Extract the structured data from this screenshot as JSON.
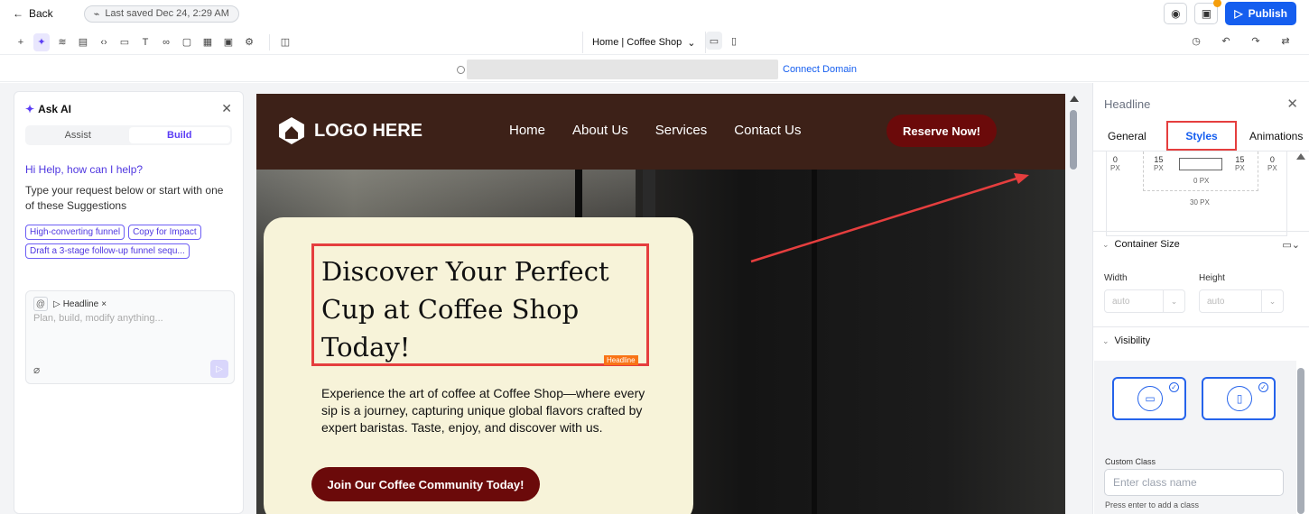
{
  "topbar": {
    "back_label": "Back",
    "saved_label": "Last saved Dec 24, 2:29 AM",
    "publish_label": "Publish",
    "icons": [
      "eye-icon",
      "save-icon",
      "publish-icon"
    ]
  },
  "toolbar": {
    "tools": [
      "add-icon",
      "ai-sparkle-icon",
      "layers-icon",
      "pages-icon",
      "code-icon",
      "forms-icon",
      "text-icon",
      "integrations-icon",
      "sections-icon",
      "templates-icon",
      "media-icon",
      "settings-icon",
      "layout-icon"
    ],
    "page_select": "Home | Coffee Shop",
    "device_options": [
      "desktop-icon",
      "mobile-icon"
    ],
    "right_tools": [
      "history-icon",
      "undo-icon",
      "redo-icon",
      "swap-icon"
    ]
  },
  "domain_bar": {
    "connect_label": "Connect Domain"
  },
  "ai_panel": {
    "title": "Ask AI",
    "tabs": [
      "Assist",
      "Build"
    ],
    "active_tab": "Build",
    "greeting": "Hi Help, how can I help?",
    "help_text": "Type your request below or start with one of these Suggestions",
    "suggestions": [
      "High-converting funnel",
      "Copy for Impact",
      "Draft a 3-stage follow-up funnel sequ..."
    ],
    "context_tag": "Headline",
    "input_placeholder": "Plan, build, modify anything..."
  },
  "site": {
    "logo_text": "LOGO HERE",
    "nav": [
      "Home",
      "About Us",
      "Services",
      "Contact Us"
    ],
    "reserve_label": "Reserve Now!",
    "headline": "Discover Your Perfect Cup at Coffee Shop Today!",
    "selection_badge": "Headline",
    "body": "Experience the art of coffee at Coffee Shop—where every sip is a journey, capturing unique global flavors crafted by expert baristas. Taste, enjoy, and discover with us.",
    "cta_label": "Join Our Coffee Community Today!",
    "colors": {
      "nav_bg": "#3d2118",
      "button_bg": "#6b0a0a",
      "card_bg": "#f7f3d9"
    }
  },
  "properties": {
    "element": "Headline",
    "tabs": [
      "General",
      "Styles",
      "Animations"
    ],
    "active_tab": "Styles",
    "spacing": {
      "margin_left": "0",
      "padding_left": "15",
      "padding_right": "15",
      "margin_right": "0",
      "padding_bottom": "0",
      "margin_bottom": "30",
      "unit": "PX"
    },
    "container_size": {
      "title": "Container Size",
      "width_label": "Width",
      "width_value": "auto",
      "height_label": "Height",
      "height_value": "auto"
    },
    "visibility": {
      "title": "Visibility",
      "devices": [
        "desktop-icon",
        "mobile-icon"
      ]
    },
    "custom_class": {
      "label": "Custom Class",
      "placeholder": "Enter class name",
      "hint": "Press enter to add a class"
    }
  }
}
